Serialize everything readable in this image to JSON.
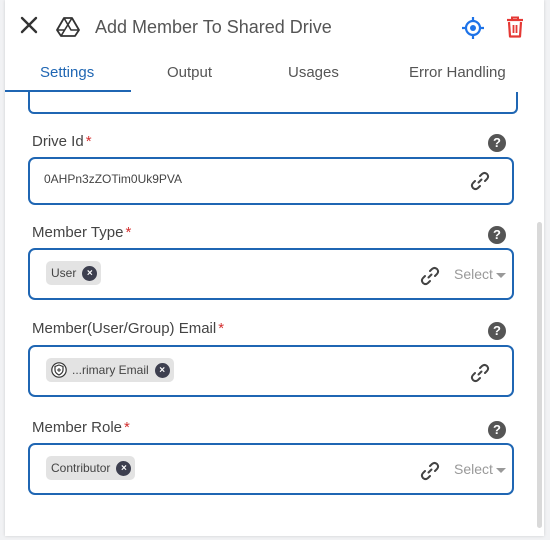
{
  "header": {
    "title": "Add Member To Shared Drive"
  },
  "tabs": [
    {
      "label": "Settings",
      "active": true
    },
    {
      "label": "Output",
      "active": false
    },
    {
      "label": "Usages",
      "active": false
    },
    {
      "label": "Error Handling",
      "active": false
    }
  ],
  "fields": {
    "drive_id": {
      "label": "Drive Id",
      "required_mark": "*",
      "value": "0AHPn3zZOTim0Uk9PVA",
      "help": "?"
    },
    "member_type": {
      "label": "Member Type",
      "required_mark": "*",
      "chip": "User",
      "select_placeholder": "Select",
      "help": "?"
    },
    "member_email": {
      "label": "Member(User/Group) Email",
      "required_mark": "*",
      "chip": "...rimary Email",
      "help": "?"
    },
    "member_role": {
      "label": "Member Role",
      "required_mark": "*",
      "chip": "Contributor",
      "select_placeholder": "Select",
      "help": "?"
    }
  },
  "colors": {
    "accent": "#1f66b3",
    "required": "#d32f2f",
    "delete": "#e53935",
    "locate": "#1e73e8"
  },
  "icons": {
    "close": "close-icon",
    "app": "google-drive-icon",
    "locate": "crosshair-icon",
    "delete": "trash-icon",
    "link": "link-icon",
    "help": "help-icon",
    "shield": "shield-icon"
  }
}
